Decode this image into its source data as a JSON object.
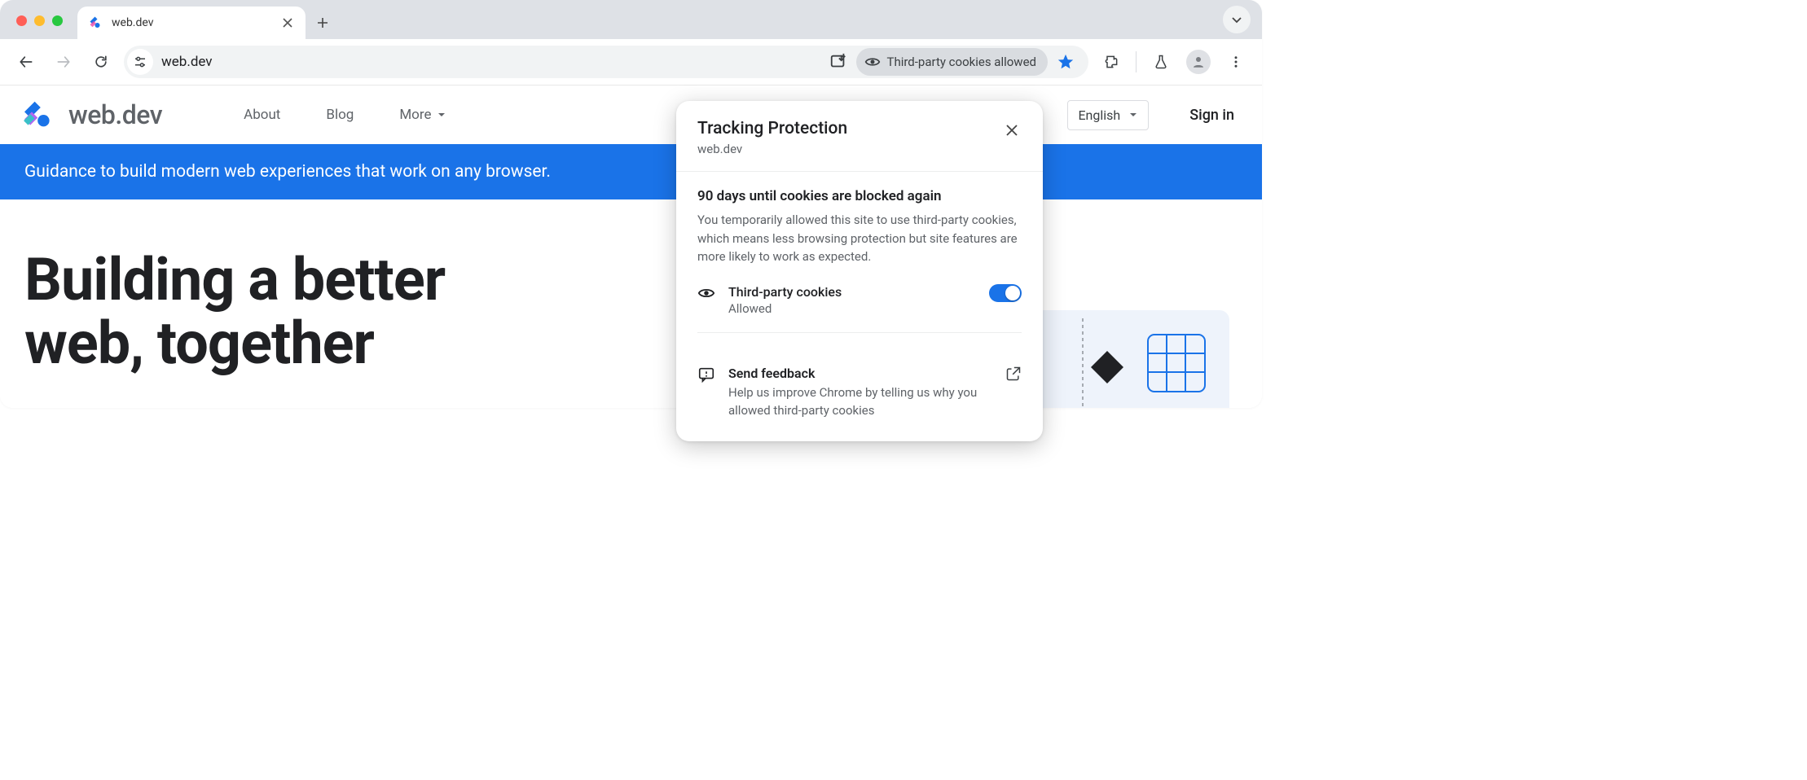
{
  "browser": {
    "tab_title": "web.dev",
    "url": "web.dev",
    "cookie_chip": "Third-party cookies allowed"
  },
  "site": {
    "name": "web.dev",
    "nav": {
      "about": "About",
      "blog": "Blog",
      "more": "More"
    },
    "language": "English",
    "signin": "Sign in",
    "banner": "Guidance to build modern web experiences that work on any browser.",
    "hero_line1": "Building a better",
    "hero_line2": "web, together"
  },
  "popup": {
    "title": "Tracking Protection",
    "site": "web.dev",
    "heading": "90 days until cookies are blocked again",
    "body": "You temporarily allowed this site to use third-party cookies, which means less browsing protection but site features are more likely to work as expected.",
    "cookie_label": "Third-party cookies",
    "cookie_status": "Allowed",
    "feedback_label": "Send feedback",
    "feedback_body": "Help us improve Chrome by telling us why you allowed third-party cookies"
  }
}
